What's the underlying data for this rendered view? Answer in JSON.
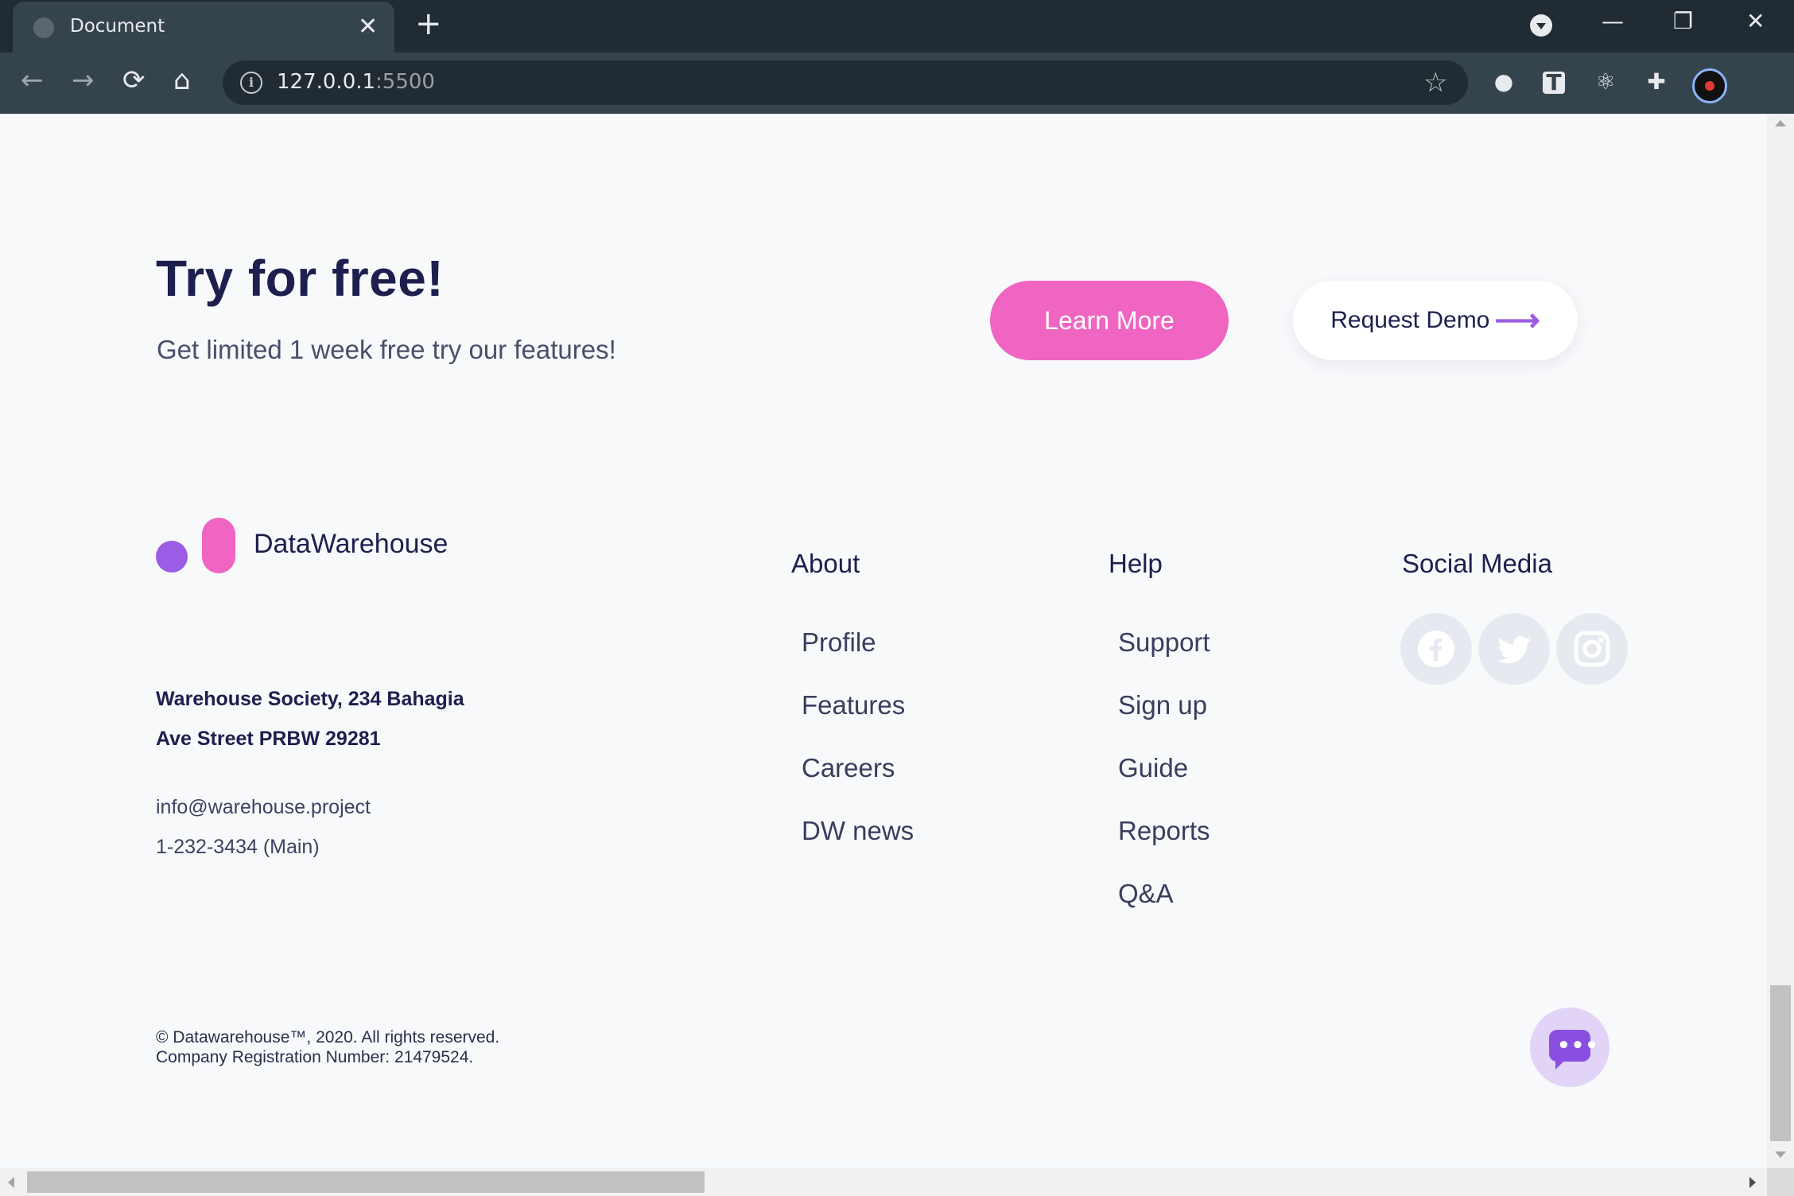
{
  "browser": {
    "tab_title": "Document",
    "tab_close": "✕",
    "new_tab": "+",
    "url_host": "127.0.0.1",
    "url_port": ":5500",
    "controls": {
      "minimize": "—",
      "restore": "❐",
      "close": "✕"
    },
    "icons": [
      "back-icon",
      "forward-icon",
      "reload-icon",
      "home-icon",
      "info-icon",
      "star-icon",
      "extensions-icon",
      "menu-icon"
    ]
  },
  "cta": {
    "title": "Try for free!",
    "subtitle": "Get limited 1 week free try our features!",
    "learn_more": "Learn More",
    "request_demo": "Request Demo",
    "accent_pink": "#f065c1",
    "accent_purple": "#9b5de5"
  },
  "footer": {
    "brand": "DataWarehouse",
    "address_line1": "Warehouse Society, 234 Bahagia",
    "address_line2": "Ave Street PRBW 29281",
    "email": "info@warehouse.project",
    "phone": "1-232-3434 (Main)",
    "about": {
      "title": "About",
      "links": [
        "Profile",
        "Features",
        "Careers",
        "DW news"
      ]
    },
    "help": {
      "title": "Help",
      "links": [
        "Support",
        "Sign up",
        "Guide",
        "Reports",
        "Q&A"
      ]
    },
    "social": {
      "title": "Social Media",
      "icons": [
        "facebook-icon",
        "twitter-icon",
        "instagram-icon"
      ]
    },
    "copyright_line1": "© Datawarehouse™, 2020. All rights reserved.",
    "copyright_line2": "Company Registration Number: 21479524."
  }
}
